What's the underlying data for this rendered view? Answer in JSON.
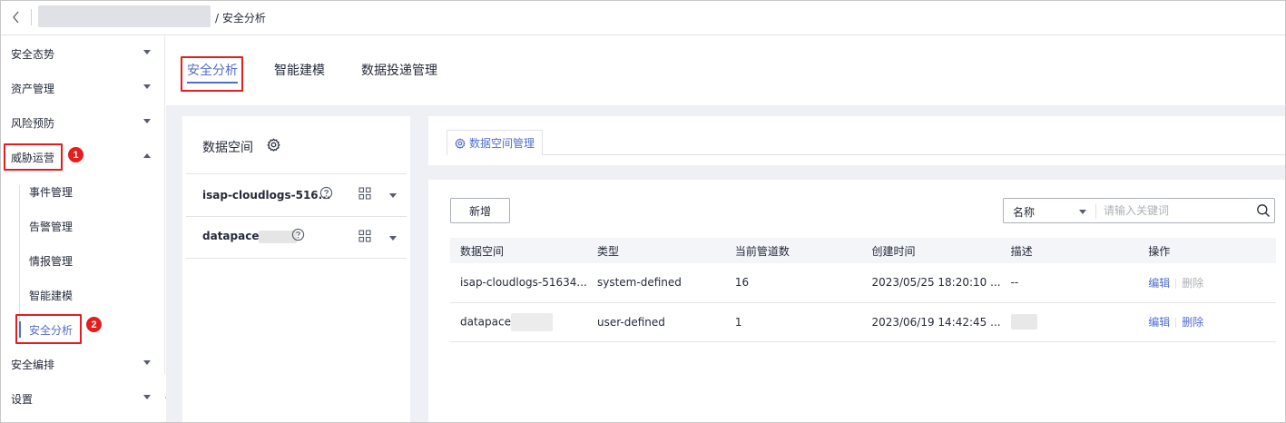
{
  "breadcrumb": {
    "current": "/ 安全分析"
  },
  "sidebar": {
    "items": [
      {
        "label": "安全态势"
      },
      {
        "label": "资产管理"
      },
      {
        "label": "风险预防"
      },
      {
        "label": "威胁运营"
      },
      {
        "label": "安全编排"
      },
      {
        "label": "设置"
      }
    ],
    "subitems": [
      {
        "label": "事件管理"
      },
      {
        "label": "告警管理"
      },
      {
        "label": "情报管理"
      },
      {
        "label": "智能建模"
      },
      {
        "label": "安全分析"
      }
    ],
    "badges": [
      "1",
      "2"
    ]
  },
  "tabs": [
    {
      "label": "安全分析"
    },
    {
      "label": "智能建模"
    },
    {
      "label": "数据投递管理"
    }
  ],
  "data_space_panel": {
    "title": "数据空间",
    "rows": [
      {
        "name": "isap-cloudlogs-516..."
      },
      {
        "name": "datapace"
      }
    ]
  },
  "right_panel": {
    "tab_label": "数据空间管理",
    "add_button": "新增",
    "search": {
      "field": "名称",
      "placeholder": "请输入关键词"
    },
    "table": {
      "headers": [
        "数据空间",
        "类型",
        "当前管道数",
        "创建时间",
        "描述",
        "操作"
      ],
      "rows": [
        {
          "space": "isap-cloudlogs-51634...",
          "type": "system-defined",
          "pipes": "16",
          "created": "2023/05/25 18:20:10 ...",
          "desc": "--",
          "edit": "编辑",
          "delete": "删除"
        },
        {
          "space": "datapace",
          "type": "user-defined",
          "pipes": "1",
          "created": "2023/06/19 14:42:45 ...",
          "desc": "",
          "edit": "编辑",
          "delete": "删除"
        }
      ]
    }
  },
  "colors": {
    "accent": "#526ecc",
    "highlight": "#e31e1e"
  }
}
